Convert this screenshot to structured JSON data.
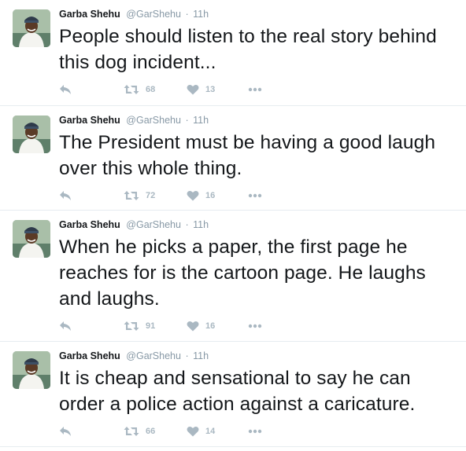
{
  "colors": {
    "name": "#14171a",
    "meta": "#8899a6",
    "icon": "#aab8c2",
    "divider": "#e6ecf0"
  },
  "icons": {
    "reply": "reply-arrow-icon",
    "retweet": "retweet-icon",
    "like": "heart-icon",
    "more": "ellipsis-icon"
  },
  "tweets": [
    {
      "author": "Garba Shehu",
      "handle": "@GarShehu",
      "separator": "·",
      "time": "11h",
      "text": "People should listen to the real story behind this dog incident...",
      "retweets": "68",
      "likes": "13"
    },
    {
      "author": "Garba Shehu",
      "handle": "@GarShehu",
      "separator": "·",
      "time": "11h",
      "text": "The President must be having a good laugh over this whole thing.",
      "retweets": "72",
      "likes": "16"
    },
    {
      "author": "Garba Shehu",
      "handle": "@GarShehu",
      "separator": "·",
      "time": "11h",
      "text": "When he picks a paper, the first page he reaches for is the cartoon page. He laughs and laughs.",
      "retweets": "91",
      "likes": "16"
    },
    {
      "author": "Garba Shehu",
      "handle": "@GarShehu",
      "separator": "·",
      "time": "11h",
      "text": "It is cheap and sensational to say he can order a police action against a caricature.",
      "retweets": "66",
      "likes": "14"
    }
  ]
}
